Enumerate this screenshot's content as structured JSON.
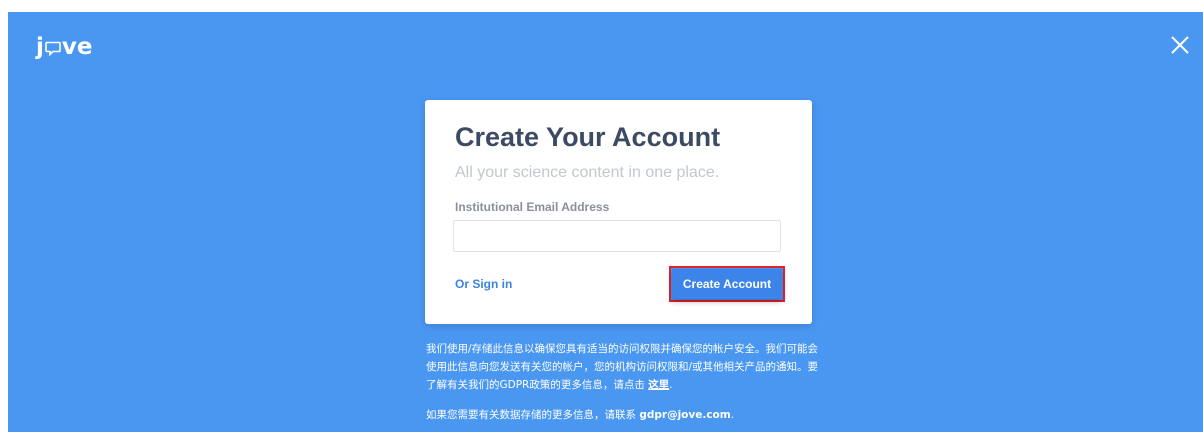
{
  "header": {
    "logo_text_left": "j",
    "logo_text_right": "ve",
    "close_icon": "close-icon"
  },
  "card": {
    "title": "Create Your Account",
    "subtitle": "All your science content in one place.",
    "email_label": "Institutional Email Address",
    "email_value": "",
    "email_placeholder": "",
    "signin_link": "Or Sign in",
    "create_button": "Create Account"
  },
  "notice": {
    "text_before_link": "我们使用/存储此信息以确保您具有适当的访问权限并确保您的帐户安全。我们可能会使用此信息向您发送有关您的帐户，您的机构访问权限和/或其他相关产品的通知。要了解有关我们的GDPR政策的更多信息，请点击 ",
    "link_here": "这里",
    "text_after_link": ".",
    "contact_before": "如果您需要有关数据存储的更多信息，请联系 ",
    "contact_email": "gdpr@jove.com",
    "contact_after": "."
  },
  "colors": {
    "background": "#4a97f2",
    "title": "#3c4a63",
    "button": "#3c84ea",
    "highlight_border": "#e8202a"
  }
}
